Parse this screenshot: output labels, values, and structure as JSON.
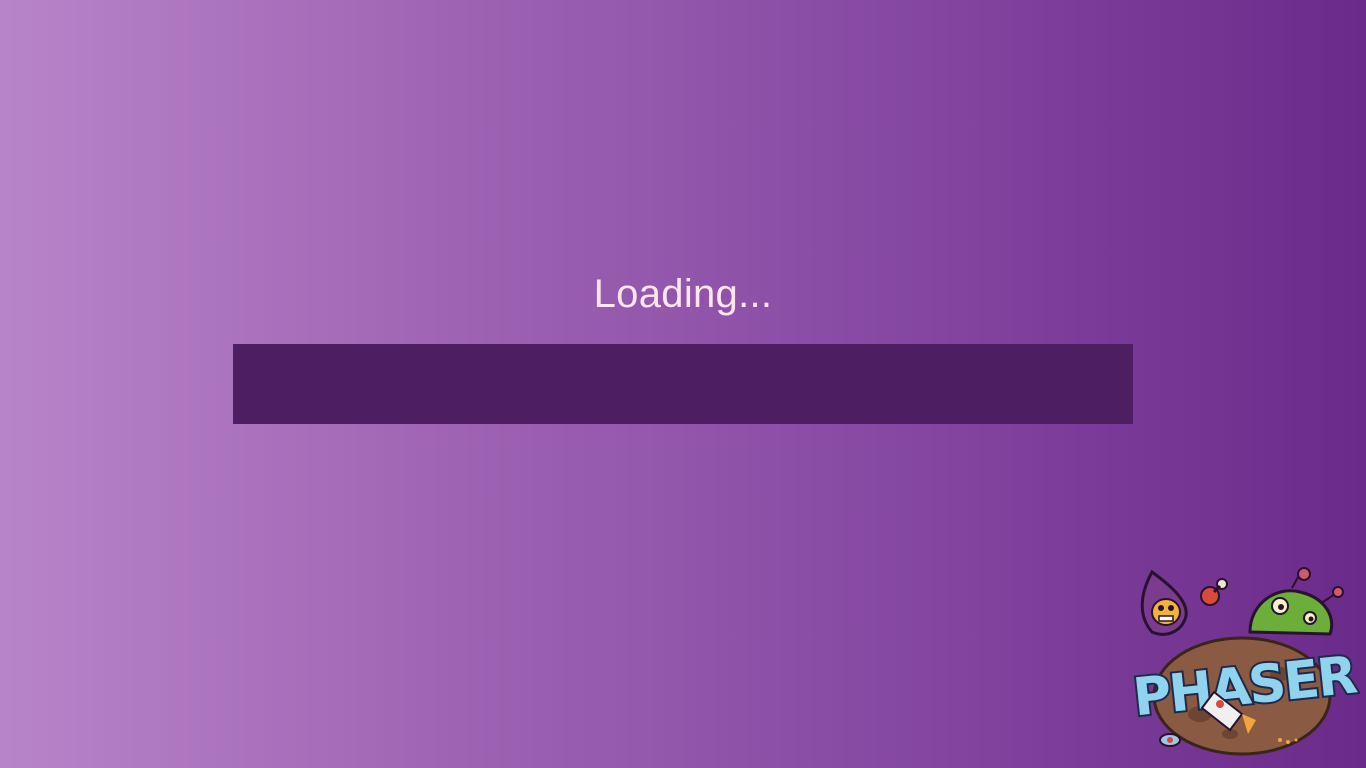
{
  "loading": {
    "text": "Loading...",
    "progress": 0
  },
  "logo": {
    "text": "PHASER",
    "icon": "phaser-logo"
  },
  "colors": {
    "background_left": "#b884c9",
    "background_right": "#6a2a8a",
    "progress_track": "#4e1e62",
    "text": "#ffe5ec"
  }
}
